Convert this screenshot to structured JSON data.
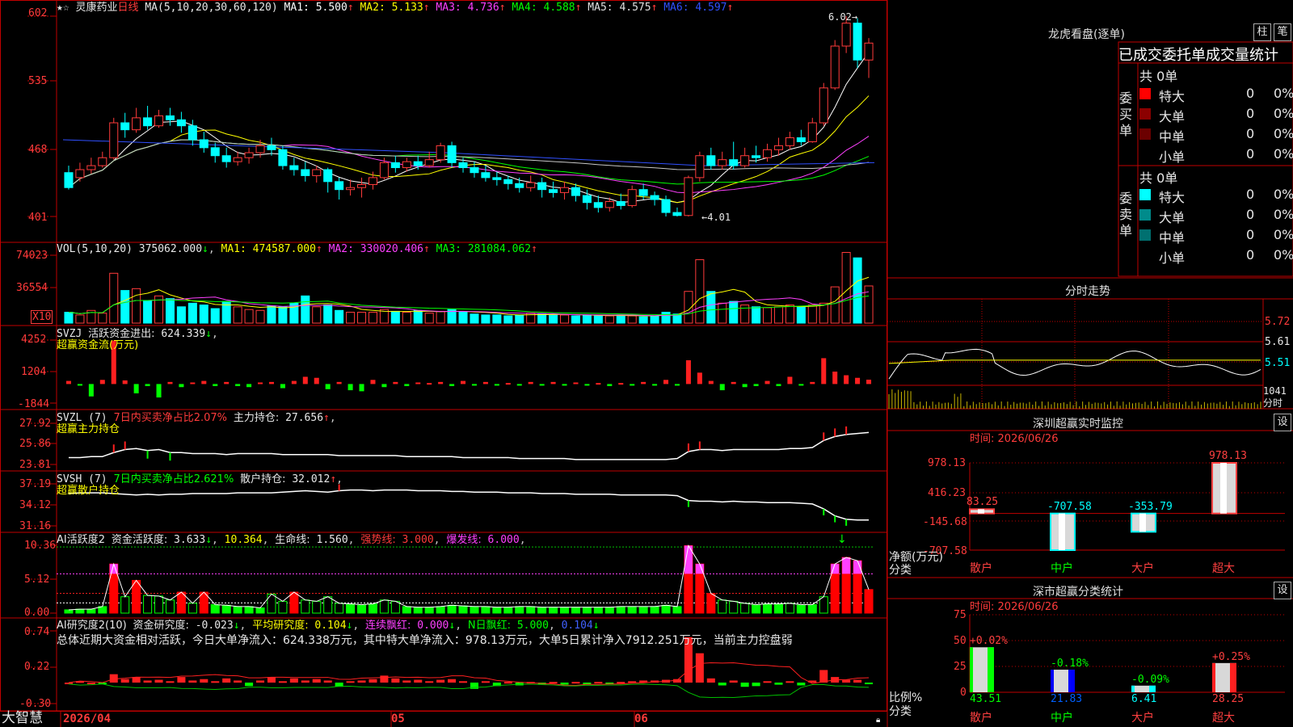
{
  "app": {
    "brand": "大智慧"
  },
  "stock": {
    "name": "灵康药业",
    "period": "日线",
    "ma_header": "MA(5,10,20,30,60,120)",
    "ma": [
      {
        "label": "MA1:",
        "value": "5.500",
        "arrow": "↑",
        "color": "#ffffff"
      },
      {
        "label": "MA2:",
        "value": "5.133",
        "arrow": "↑",
        "color": "#ffff00"
      },
      {
        "label": "MA3:",
        "value": "4.736",
        "arrow": "↑",
        "color": "#ff40ff"
      },
      {
        "label": "MA4:",
        "value": "4.588",
        "arrow": "↑",
        "color": "#00ff00"
      },
      {
        "label": "MA5:",
        "value": "4.575",
        "arrow": "↑",
        "color": "#e0e0e0"
      },
      {
        "label": "MA6:",
        "value": "4.597",
        "arrow": "↑",
        "color": "#3050ff"
      }
    ],
    "price_axis": [
      "602",
      "535",
      "468",
      "401"
    ],
    "high_label": "6.02",
    "low_label": "4.01"
  },
  "volume": {
    "header": "VOL(5,10,20)",
    "value": "375062.000",
    "value_arrow": "↓",
    "ma": [
      {
        "label": "MA1:",
        "value": "474587.000",
        "arrow": "↑",
        "color": "#ffff00"
      },
      {
        "label": "MA2:",
        "value": "330020.406",
        "arrow": "↑",
        "color": "#ff40ff"
      },
      {
        "label": "MA3:",
        "value": "281084.062",
        "arrow": "↑",
        "color": "#00ff00"
      }
    ],
    "axis": [
      "74023",
      "36554"
    ],
    "unit": "X10"
  },
  "svzj": {
    "header": "SVZJ",
    "label": "活跃资金进出:",
    "value": "624.339",
    "arrow": "↓",
    "subtitle": "超赢资金流(万元)",
    "axis": [
      "4252",
      "1204",
      "-1844"
    ]
  },
  "svzl": {
    "header": "SVZL (7)",
    "label1": "7日内买卖净占比2.07%",
    "label2": "主力持仓:",
    "value": "27.656",
    "arrow": "↑",
    "subtitle": "超赢主力持仓",
    "axis": [
      "27.92",
      "25.86",
      "23.81"
    ]
  },
  "svsh": {
    "header": "SVSH (7)",
    "label1": "7日内买卖净占比2.621%",
    "label2": "散户持仓:",
    "value": "32.012",
    "arrow": "↑",
    "subtitle": "超赢散户持仓",
    "axis": [
      "37.19",
      "34.12",
      "31.16"
    ]
  },
  "ai_active": {
    "header": "AI活跃度2",
    "label": "资金活跃度:",
    "value": "3.633",
    "arrow": "↓",
    "v2": "10.364",
    "life_label": "生命线:",
    "life_value": "1.560",
    "strong_label": "强势线:",
    "strong_value": "3.000",
    "burst_label": "爆发线:",
    "burst_value": "6.000",
    "axis": [
      "10.36",
      "5.12",
      "0.00"
    ]
  },
  "ai_research": {
    "header": "AI研究度2(10)",
    "label": "资金研究度:",
    "value": "-0.023",
    "arrow": "↓",
    "avg_label": "平均研究度:",
    "avg_value": "0.104",
    "avg_arrow": "↓",
    "red_label": "连续飘红:",
    "red_value": "0.000",
    "red_arrow": "↓",
    "n_label": "N日飘红:",
    "n_value": "5.000",
    "n_value2": "0.104",
    "n_arrow": "↓",
    "summary": "总体近期大资金相对活跃，今日大单净流入：624.338万元，其中特大单净流入：978.13万元，大单5日累计净入7912.251万元，当前主力控盘弱",
    "axis": [
      "0.74",
      "0.22",
      "-0.30"
    ]
  },
  "date_axis": {
    "start": "2026/04",
    "m05": "05",
    "m06": "06"
  },
  "longhu": {
    "title": "龙虎看盘(逐单)",
    "btn_bar": "柱",
    "btn_pen": "笔",
    "tabs": [
      "已成交",
      "委托单",
      "成交量统计"
    ],
    "buy": {
      "side_label": "委买单",
      "total": "共 0单",
      "rows": [
        {
          "name": "特大",
          "v": "0",
          "p": "0%",
          "color": "#ff0000"
        },
        {
          "name": "大单",
          "v": "0",
          "p": "0%",
          "color": "#8b0000"
        },
        {
          "name": "中单",
          "v": "0",
          "p": "0%",
          "color": "#6b0000"
        },
        {
          "name": "小单",
          "v": "0",
          "p": "0%",
          "color": "#000000"
        }
      ]
    },
    "sell": {
      "side_label": "委卖单",
      "total": "共 0单",
      "rows": [
        {
          "name": "特大",
          "v": "0",
          "p": "0%",
          "color": "#00ffff"
        },
        {
          "name": "大单",
          "v": "0",
          "p": "0%",
          "color": "#008b8b"
        },
        {
          "name": "中单",
          "v": "0",
          "p": "0%",
          "color": "#007070"
        },
        {
          "name": "小单",
          "v": "0",
          "p": "0%",
          "color": "#000000"
        }
      ]
    }
  },
  "intraday": {
    "title": "分时走势",
    "axis": [
      "5.72",
      "5.61",
      "5.51"
    ],
    "vol_label": "1041",
    "vol_label2": "分时"
  },
  "sz_monitor": {
    "title": "深圳超赢实时监控",
    "btn": "设",
    "time_label": "时间:",
    "time": "2026/06/26",
    "axis": [
      "978.13",
      "416.23",
      "-145.68",
      "-707.58"
    ],
    "unit_label": "净额(万元)",
    "cat_label": "分类",
    "bars": [
      {
        "name": "散户",
        "value": "83.25"
      },
      {
        "name": "中户",
        "value": "-707.58"
      },
      {
        "name": "大户",
        "value": "-353.79"
      },
      {
        "name": "超大",
        "value": "978.13"
      }
    ]
  },
  "sz_classify": {
    "title": "深市超赢分类统计",
    "btn": "设",
    "time_label": "时间:",
    "time": "2026/06/26",
    "axis": [
      "75",
      "50",
      "25",
      "0"
    ],
    "unit_label": "比例%",
    "cat_label": "分类",
    "bars": [
      {
        "name": "散户",
        "pct": "43.51",
        "chg": "+0.02%"
      },
      {
        "name": "中户",
        "pct": "21.83",
        "chg": "-0.18%"
      },
      {
        "name": "大户",
        "pct": "6.41",
        "chg": "-0.09%"
      },
      {
        "name": "超大",
        "pct": "28.25",
        "chg": "+0.25%"
      }
    ]
  },
  "chart_data": {
    "type": "candlestick",
    "price_ylim": [
      380,
      620
    ],
    "candles": [
      [
        4.45,
        4.3,
        4.52,
        4.28
      ],
      [
        4.4,
        4.48,
        4.55,
        4.36
      ],
      [
        4.48,
        4.52,
        4.6,
        4.44
      ],
      [
        4.52,
        4.6,
        4.66,
        4.5
      ],
      [
        4.6,
        4.95,
        5.0,
        4.58
      ],
      [
        4.95,
        4.88,
        5.05,
        4.8
      ],
      [
        4.88,
        5.0,
        5.1,
        4.85
      ],
      [
        5.0,
        4.92,
        5.12,
        4.88
      ],
      [
        4.92,
        5.02,
        5.08,
        4.9
      ],
      [
        5.02,
        4.98,
        5.1,
        4.92
      ],
      [
        4.98,
        4.92,
        5.06,
        4.85
      ],
      [
        4.92,
        4.78,
        4.98,
        4.72
      ],
      [
        4.78,
        4.7,
        4.86,
        4.65
      ],
      [
        4.7,
        4.62,
        4.75,
        4.55
      ],
      [
        4.62,
        4.56,
        4.7,
        4.5
      ],
      [
        4.56,
        4.6,
        4.66,
        4.52
      ],
      [
        4.6,
        4.65,
        4.7,
        4.54
      ],
      [
        4.65,
        4.72,
        4.78,
        4.6
      ],
      [
        4.72,
        4.68,
        4.8,
        4.62
      ],
      [
        4.68,
        4.52,
        4.72,
        4.48
      ],
      [
        4.52,
        4.48,
        4.6,
        4.42
      ],
      [
        4.48,
        4.42,
        4.56,
        4.36
      ],
      [
        4.42,
        4.48,
        4.52,
        4.35
      ],
      [
        4.48,
        4.36,
        4.5,
        4.25
      ],
      [
        4.36,
        4.28,
        4.4,
        4.18
      ],
      [
        4.28,
        4.3,
        4.38,
        4.22
      ],
      [
        4.3,
        4.33,
        4.4,
        4.2
      ],
      [
        4.33,
        4.4,
        4.46,
        4.28
      ],
      [
        4.4,
        4.55,
        4.6,
        4.38
      ],
      [
        4.55,
        4.5,
        4.62,
        4.45
      ],
      [
        4.5,
        4.56,
        4.6,
        4.46
      ],
      [
        4.56,
        4.52,
        4.62,
        4.48
      ],
      [
        4.52,
        4.58,
        4.66,
        4.5
      ],
      [
        4.58,
        4.72,
        4.75,
        4.55
      ],
      [
        4.72,
        4.55,
        4.76,
        4.5
      ],
      [
        4.55,
        4.5,
        4.6,
        4.45
      ],
      [
        4.5,
        4.45,
        4.56,
        4.4
      ],
      [
        4.45,
        4.4,
        4.52,
        4.36
      ],
      [
        4.4,
        4.38,
        4.46,
        4.32
      ],
      [
        4.38,
        4.34,
        4.42,
        4.28
      ],
      [
        4.34,
        4.3,
        4.4,
        4.25
      ],
      [
        4.3,
        4.35,
        4.42,
        4.26
      ],
      [
        4.35,
        4.28,
        4.4,
        4.2
      ],
      [
        4.28,
        4.25,
        4.36,
        4.2
      ],
      [
        4.25,
        4.3,
        4.36,
        4.18
      ],
      [
        4.3,
        4.22,
        4.34,
        4.16
      ],
      [
        4.22,
        4.15,
        4.28,
        4.08
      ],
      [
        4.15,
        4.1,
        4.22,
        4.05
      ],
      [
        4.1,
        4.16,
        4.2,
        4.06
      ],
      [
        4.16,
        4.12,
        4.24,
        4.08
      ],
      [
        4.12,
        4.28,
        4.32,
        4.1
      ],
      [
        4.28,
        4.22,
        4.34,
        4.18
      ],
      [
        4.22,
        4.18,
        4.26,
        4.12
      ],
      [
        4.18,
        4.05,
        4.22,
        4.01
      ],
      [
        4.05,
        4.02,
        4.1,
        4.01
      ],
      [
        4.02,
        4.4,
        4.42,
        4.01
      ],
      [
        4.4,
        4.62,
        4.66,
        4.36
      ],
      [
        4.62,
        4.52,
        4.7,
        4.48
      ],
      [
        4.52,
        4.58,
        4.66,
        4.48
      ],
      [
        4.58,
        4.52,
        4.76,
        4.48
      ],
      [
        4.52,
        4.62,
        4.7,
        4.5
      ],
      [
        4.62,
        4.6,
        4.72,
        4.55
      ],
      [
        4.6,
        4.68,
        4.74,
        4.56
      ],
      [
        4.68,
        4.72,
        4.8,
        4.62
      ],
      [
        4.72,
        4.8,
        4.86,
        4.68
      ],
      [
        4.8,
        4.76,
        4.88,
        4.72
      ],
      [
        4.76,
        4.95,
        5.0,
        4.75
      ],
      [
        4.95,
        5.3,
        5.35,
        4.92
      ],
      [
        5.3,
        5.72,
        5.78,
        5.28
      ],
      [
        5.72,
        5.95,
        6.02,
        5.65
      ],
      [
        5.95,
        5.58,
        6.0,
        5.5
      ],
      [
        5.58,
        5.75,
        5.8,
        5.4
      ]
    ],
    "volume_ylim": [
      0,
      82000
    ],
    "volume": [
      12000,
      9000,
      14000,
      11000,
      55000,
      36000,
      38000,
      25000,
      30000,
      27000,
      18000,
      22000,
      20000,
      16000,
      24000,
      18000,
      15000,
      14000,
      19000,
      18000,
      22000,
      30000,
      18000,
      20000,
      14000,
      12000,
      12000,
      12000,
      15000,
      13000,
      12000,
      14000,
      11000,
      13000,
      15000,
      12000,
      10000,
      9000,
      9000,
      8000,
      9000,
      11000,
      10000,
      9000,
      9000,
      8000,
      9000,
      8000,
      8000,
      9000,
      8000,
      7000,
      8000,
      12000,
      10000,
      35000,
      70000,
      35000,
      22000,
      24000,
      20000,
      18000,
      17000,
      18000,
      20000,
      18000,
      20000,
      22000,
      40000,
      78000,
      72000,
      41000
    ],
    "svzj_ylim": [
      -1844,
      4252
    ],
    "svzj": [
      300,
      -80,
      -1200,
      400,
      4200,
      350,
      -900,
      -200,
      -1300,
      200,
      -300,
      150,
      300,
      -200,
      200,
      -200,
      -300,
      150,
      200,
      -400,
      300,
      700,
      600,
      -500,
      200,
      -600,
      -700,
      400,
      -300,
      200,
      -200,
      150,
      100,
      200,
      -200,
      300,
      -100,
      200,
      -150,
      100,
      -100,
      200,
      -100,
      200,
      -100,
      150,
      -100,
      100,
      -200,
      100,
      -100,
      200,
      -100,
      400,
      -100,
      2300,
      1100,
      300,
      -600,
      200,
      -300,
      -200,
      300,
      -200,
      700,
      -150,
      200,
      2500,
      1200,
      850,
      600,
      420
    ],
    "svzl_ylim": [
      23.81,
      27.92
    ],
    "svzl": [
      24.5,
      24.5,
      24.6,
      24.6,
      25.0,
      25.3,
      25.4,
      25.2,
      25.3,
      25.0,
      25.0,
      24.9,
      24.9,
      24.9,
      24.8,
      24.9,
      24.9,
      24.9,
      24.9,
      24.8,
      24.8,
      24.8,
      24.8,
      24.8,
      24.7,
      24.7,
      24.7,
      24.7,
      24.7,
      24.7,
      24.6,
      24.6,
      24.6,
      24.6,
      24.6,
      24.5,
      24.5,
      24.5,
      24.5,
      24.5,
      24.4,
      24.4,
      24.4,
      24.4,
      24.4,
      24.3,
      24.3,
      24.3,
      24.3,
      24.3,
      24.3,
      24.3,
      24.3,
      24.3,
      24.4,
      25.1,
      25.3,
      25.3,
      25.2,
      25.3,
      25.3,
      25.3,
      25.3,
      25.3,
      25.4,
      25.4,
      25.5,
      26.2,
      26.6,
      26.8,
      26.9,
      27.0
    ],
    "svsh_ylim": [
      31.16,
      37.19
    ],
    "svsh": [
      35.8,
      35.9,
      35.9,
      35.9,
      35.8,
      35.7,
      35.6,
      35.7,
      35.6,
      35.7,
      35.7,
      35.8,
      35.8,
      35.8,
      35.8,
      35.9,
      35.9,
      35.9,
      35.9,
      36.0,
      36.1,
      36.2,
      36.1,
      36.0,
      36.2,
      36.3,
      36.3,
      36.2,
      36.3,
      36.3,
      36.3,
      36.2,
      36.2,
      36.2,
      36.1,
      36.1,
      36.0,
      36.0,
      36.0,
      35.9,
      35.9,
      35.9,
      35.8,
      35.8,
      35.8,
      35.7,
      35.7,
      35.7,
      35.7,
      35.6,
      35.6,
      35.6,
      35.6,
      35.6,
      35.5,
      34.8,
      34.7,
      34.7,
      34.6,
      34.7,
      34.6,
      34.6,
      34.5,
      34.5,
      34.5,
      34.4,
      34.3,
      33.6,
      32.6,
      32.1,
      32.0,
      32.0
    ],
    "ai_active_ylim": [
      0,
      10.36
    ],
    "ai_active": [
      0.5,
      0.6,
      0.6,
      1.0,
      7.5,
      2.5,
      5.0,
      2.7,
      2.6,
      2.0,
      3.2,
      1.5,
      3.2,
      1.3,
      1.2,
      1.0,
      1.0,
      0.8,
      2.9,
      1.8,
      3.2,
      2.0,
      1.8,
      2.5,
      1.5,
      1.4,
      1.3,
      1.4,
      2.0,
      1.8,
      1.0,
      0.9,
      0.9,
      1.0,
      1.2,
      1.1,
      1.0,
      1.0,
      0.9,
      0.9,
      1.0,
      1.0,
      0.9,
      0.9,
      0.9,
      0.9,
      0.9,
      0.9,
      0.9,
      1.0,
      1.0,
      1.0,
      1.0,
      1.2,
      1.0,
      10.3,
      7.5,
      3.0,
      2.0,
      1.8,
      1.5,
      1.3,
      1.4,
      1.4,
      1.5,
      1.3,
      1.3,
      2.5,
      7.5,
      8.5,
      8.0,
      3.6
    ],
    "ai_research_ylim": [
      -0.3,
      0.74
    ],
    "ai_research": [
      0.0,
      0.02,
      0.0,
      -0.02,
      0.12,
      0.05,
      0.08,
      0.03,
      0.04,
      0.02,
      0.08,
      0.03,
      0.05,
      0.02,
      0.06,
      0.03,
      -0.05,
      0.03,
      0.08,
      0.02,
      0.06,
      0.03,
      0.05,
      0.03,
      -0.06,
      0.02,
      0.03,
      0.05,
      0.1,
      0.06,
      0.03,
      0.04,
      0.02,
      0.04,
      0.05,
      0.02,
      -0.09,
      0.02,
      -0.05,
      0.01,
      -0.04,
      0.01,
      -0.03,
      0.01,
      -0.03,
      0.01,
      -0.02,
      0.01,
      -0.02,
      0.01,
      0.02,
      0.03,
      0.03,
      0.04,
      0.05,
      0.65,
      0.42,
      0.06,
      -0.04,
      0.03,
      -0.06,
      -0.05,
      0.02,
      -0.03,
      0.02,
      -0.04,
      0.03,
      0.18,
      0.08,
      0.04,
      0.04,
      -0.02
    ]
  }
}
